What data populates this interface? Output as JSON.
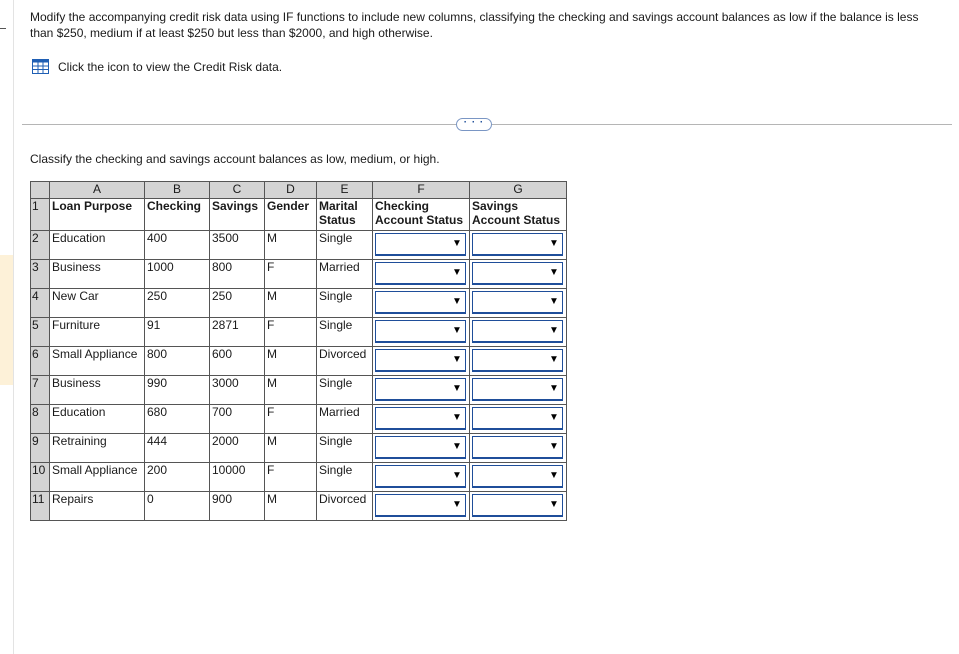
{
  "instructions": "Modify the accompanying credit risk data using IF functions to include new columns, classifying the checking and savings account balances as low if the balance is less than $250, medium if at least $250 but less than $2000, and high otherwise.",
  "data_link": {
    "icon": "spreadsheet-grid-icon",
    "label": "Click the icon to view the Credit Risk data."
  },
  "more_button": {
    "label": "· · ·"
  },
  "prompt": "Classify the checking and savings account balances as low, medium, or high.",
  "sheet": {
    "col_letters": [
      "A",
      "B",
      "C",
      "D",
      "E",
      "F",
      "G"
    ],
    "header_row_number": "1",
    "headers": {
      "loan_purpose": "Loan Purpose",
      "checking": "Checking",
      "savings": "Savings",
      "gender": "Gender",
      "marital_status": "Marital Status",
      "checking_status": "Checking Account Status",
      "savings_status": "Savings Account Status"
    },
    "rows": [
      {
        "num": "2",
        "loan_purpose": "Education",
        "checking": "400",
        "savings": "3500",
        "gender": "M",
        "marital": "Single",
        "checking_status": "",
        "savings_status": ""
      },
      {
        "num": "3",
        "loan_purpose": "Business",
        "checking": "1000",
        "savings": "800",
        "gender": "F",
        "marital": "Married",
        "checking_status": "",
        "savings_status": ""
      },
      {
        "num": "4",
        "loan_purpose": "New Car",
        "checking": "250",
        "savings": "250",
        "gender": "M",
        "marital": "Single",
        "checking_status": "",
        "savings_status": ""
      },
      {
        "num": "5",
        "loan_purpose": "Furniture",
        "checking": "91",
        "savings": "2871",
        "gender": "F",
        "marital": "Single",
        "checking_status": "",
        "savings_status": ""
      },
      {
        "num": "6",
        "loan_purpose": "Small Appliance",
        "checking": "800",
        "savings": "600",
        "gender": "M",
        "marital": "Divorced",
        "checking_status": "",
        "savings_status": ""
      },
      {
        "num": "7",
        "loan_purpose": "Business",
        "checking": "990",
        "savings": "3000",
        "gender": "M",
        "marital": "Single",
        "checking_status": "",
        "savings_status": ""
      },
      {
        "num": "8",
        "loan_purpose": "Education",
        "checking": "680",
        "savings": "700",
        "gender": "F",
        "marital": "Married",
        "checking_status": "",
        "savings_status": ""
      },
      {
        "num": "9",
        "loan_purpose": "Retraining",
        "checking": "444",
        "savings": "2000",
        "gender": "M",
        "marital": "Single",
        "checking_status": "",
        "savings_status": ""
      },
      {
        "num": "10",
        "loan_purpose": "Small Appliance",
        "checking": "200",
        "savings": "10000",
        "gender": "F",
        "marital": "Single",
        "checking_status": "",
        "savings_status": ""
      },
      {
        "num": "11",
        "loan_purpose": "Repairs",
        "checking": "0",
        "savings": "900",
        "gender": "M",
        "marital": "Divorced",
        "checking_status": "",
        "savings_status": ""
      }
    ],
    "dropdown_arrow": "▼"
  },
  "colors": {
    "header_gray": "#d4d4d4",
    "dropdown_border": "#1f4e9a",
    "link_blue": "#1f4e9a"
  }
}
